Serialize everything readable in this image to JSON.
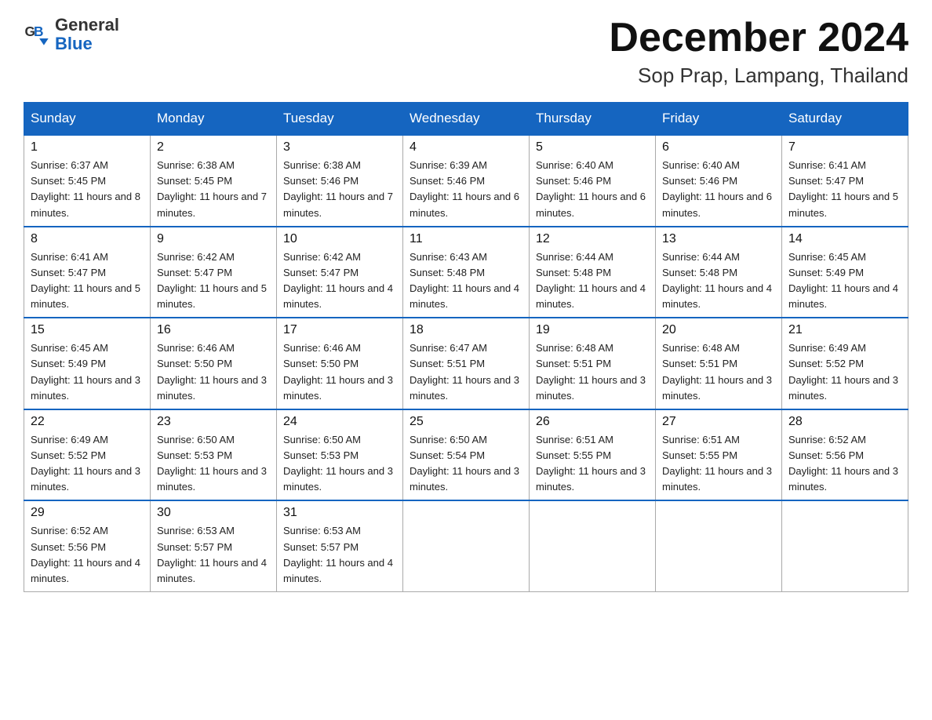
{
  "header": {
    "logo_general": "General",
    "logo_blue": "Blue",
    "month_title": "December 2024",
    "location": "Sop Prap, Lampang, Thailand"
  },
  "days_of_week": [
    "Sunday",
    "Monday",
    "Tuesday",
    "Wednesday",
    "Thursday",
    "Friday",
    "Saturday"
  ],
  "weeks": [
    [
      {
        "day": "1",
        "sunrise": "6:37 AM",
        "sunset": "5:45 PM",
        "daylight": "11 hours and 8 minutes."
      },
      {
        "day": "2",
        "sunrise": "6:38 AM",
        "sunset": "5:45 PM",
        "daylight": "11 hours and 7 minutes."
      },
      {
        "day": "3",
        "sunrise": "6:38 AM",
        "sunset": "5:46 PM",
        "daylight": "11 hours and 7 minutes."
      },
      {
        "day": "4",
        "sunrise": "6:39 AM",
        "sunset": "5:46 PM",
        "daylight": "11 hours and 6 minutes."
      },
      {
        "day": "5",
        "sunrise": "6:40 AM",
        "sunset": "5:46 PM",
        "daylight": "11 hours and 6 minutes."
      },
      {
        "day": "6",
        "sunrise": "6:40 AM",
        "sunset": "5:46 PM",
        "daylight": "11 hours and 6 minutes."
      },
      {
        "day": "7",
        "sunrise": "6:41 AM",
        "sunset": "5:47 PM",
        "daylight": "11 hours and 5 minutes."
      }
    ],
    [
      {
        "day": "8",
        "sunrise": "6:41 AM",
        "sunset": "5:47 PM",
        "daylight": "11 hours and 5 minutes."
      },
      {
        "day": "9",
        "sunrise": "6:42 AM",
        "sunset": "5:47 PM",
        "daylight": "11 hours and 5 minutes."
      },
      {
        "day": "10",
        "sunrise": "6:42 AM",
        "sunset": "5:47 PM",
        "daylight": "11 hours and 4 minutes."
      },
      {
        "day": "11",
        "sunrise": "6:43 AM",
        "sunset": "5:48 PM",
        "daylight": "11 hours and 4 minutes."
      },
      {
        "day": "12",
        "sunrise": "6:44 AM",
        "sunset": "5:48 PM",
        "daylight": "11 hours and 4 minutes."
      },
      {
        "day": "13",
        "sunrise": "6:44 AM",
        "sunset": "5:48 PM",
        "daylight": "11 hours and 4 minutes."
      },
      {
        "day": "14",
        "sunrise": "6:45 AM",
        "sunset": "5:49 PM",
        "daylight": "11 hours and 4 minutes."
      }
    ],
    [
      {
        "day": "15",
        "sunrise": "6:45 AM",
        "sunset": "5:49 PM",
        "daylight": "11 hours and 3 minutes."
      },
      {
        "day": "16",
        "sunrise": "6:46 AM",
        "sunset": "5:50 PM",
        "daylight": "11 hours and 3 minutes."
      },
      {
        "day": "17",
        "sunrise": "6:46 AM",
        "sunset": "5:50 PM",
        "daylight": "11 hours and 3 minutes."
      },
      {
        "day": "18",
        "sunrise": "6:47 AM",
        "sunset": "5:51 PM",
        "daylight": "11 hours and 3 minutes."
      },
      {
        "day": "19",
        "sunrise": "6:48 AM",
        "sunset": "5:51 PM",
        "daylight": "11 hours and 3 minutes."
      },
      {
        "day": "20",
        "sunrise": "6:48 AM",
        "sunset": "5:51 PM",
        "daylight": "11 hours and 3 minutes."
      },
      {
        "day": "21",
        "sunrise": "6:49 AM",
        "sunset": "5:52 PM",
        "daylight": "11 hours and 3 minutes."
      }
    ],
    [
      {
        "day": "22",
        "sunrise": "6:49 AM",
        "sunset": "5:52 PM",
        "daylight": "11 hours and 3 minutes."
      },
      {
        "day": "23",
        "sunrise": "6:50 AM",
        "sunset": "5:53 PM",
        "daylight": "11 hours and 3 minutes."
      },
      {
        "day": "24",
        "sunrise": "6:50 AM",
        "sunset": "5:53 PM",
        "daylight": "11 hours and 3 minutes."
      },
      {
        "day": "25",
        "sunrise": "6:50 AM",
        "sunset": "5:54 PM",
        "daylight": "11 hours and 3 minutes."
      },
      {
        "day": "26",
        "sunrise": "6:51 AM",
        "sunset": "5:55 PM",
        "daylight": "11 hours and 3 minutes."
      },
      {
        "day": "27",
        "sunrise": "6:51 AM",
        "sunset": "5:55 PM",
        "daylight": "11 hours and 3 minutes."
      },
      {
        "day": "28",
        "sunrise": "6:52 AM",
        "sunset": "5:56 PM",
        "daylight": "11 hours and 3 minutes."
      }
    ],
    [
      {
        "day": "29",
        "sunrise": "6:52 AM",
        "sunset": "5:56 PM",
        "daylight": "11 hours and 4 minutes."
      },
      {
        "day": "30",
        "sunrise": "6:53 AM",
        "sunset": "5:57 PM",
        "daylight": "11 hours and 4 minutes."
      },
      {
        "day": "31",
        "sunrise": "6:53 AM",
        "sunset": "5:57 PM",
        "daylight": "11 hours and 4 minutes."
      },
      null,
      null,
      null,
      null
    ]
  ]
}
